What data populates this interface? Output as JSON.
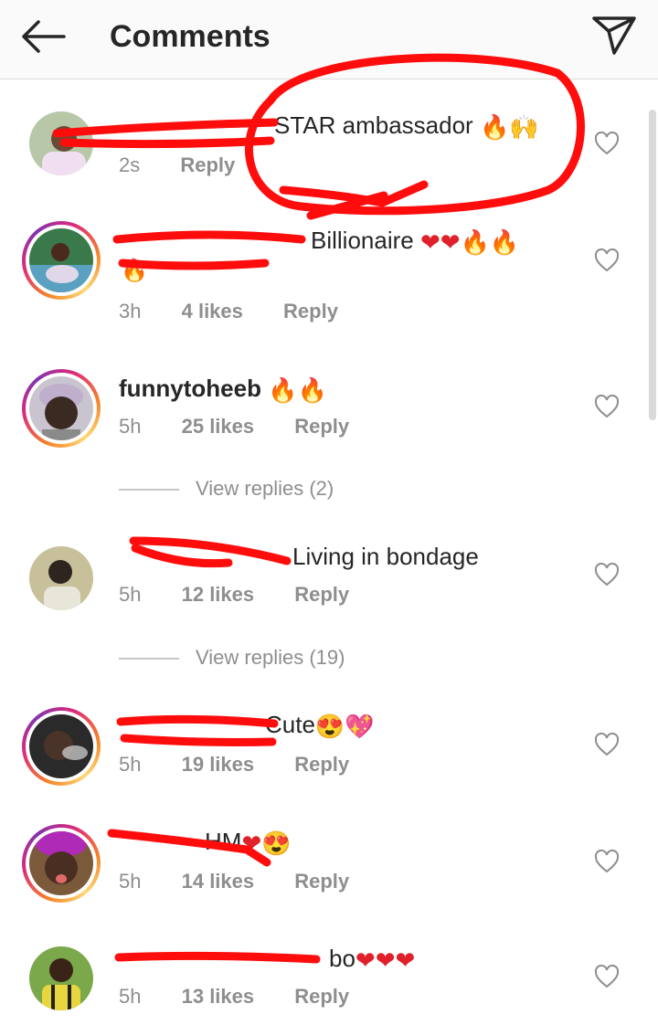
{
  "header": {
    "title": "Comments",
    "back_icon": "arrow-left-icon",
    "share_icon": "paper-plane-icon"
  },
  "comments": [
    {
      "username": "",
      "text": "STAR ambassador",
      "emoji": "🔥🙌",
      "time": "2s",
      "likes": "",
      "reply": "Reply",
      "story_ring": false
    },
    {
      "username": "",
      "text": "Billionaire",
      "emoji": "❤❤🔥🔥🔥",
      "time": "3h",
      "likes": "4 likes",
      "reply": "Reply",
      "story_ring": true
    },
    {
      "username": "funnytoheeb",
      "text": "",
      "emoji": "🔥🔥",
      "time": "5h",
      "likes": "25 likes",
      "reply": "Reply",
      "story_ring": true
    },
    {
      "username": "",
      "text": "Living in bondage",
      "emoji": "",
      "time": "5h",
      "likes": "12 likes",
      "reply": "Reply",
      "story_ring": false
    },
    {
      "username": "",
      "text": "Cute",
      "emoji": "😍💖",
      "time": "5h",
      "likes": "19 likes",
      "reply": "Reply",
      "story_ring": true
    },
    {
      "username": "",
      "text": "HM",
      "emoji": "❤😍",
      "time": "5h",
      "likes": "14 likes",
      "reply": "Reply",
      "story_ring": true
    },
    {
      "username": "",
      "text": "bo",
      "emoji": "❤❤❤",
      "time": "5h",
      "likes": "13 likes",
      "reply": "Reply",
      "story_ring": false
    }
  ],
  "view_replies": [
    {
      "label": "View replies (2)"
    },
    {
      "label": "View replies (19)"
    }
  ],
  "colors": {
    "heart_red": "#e0202a",
    "scribble_red": "#ff0d0d",
    "muted": "#8e8e8e"
  }
}
